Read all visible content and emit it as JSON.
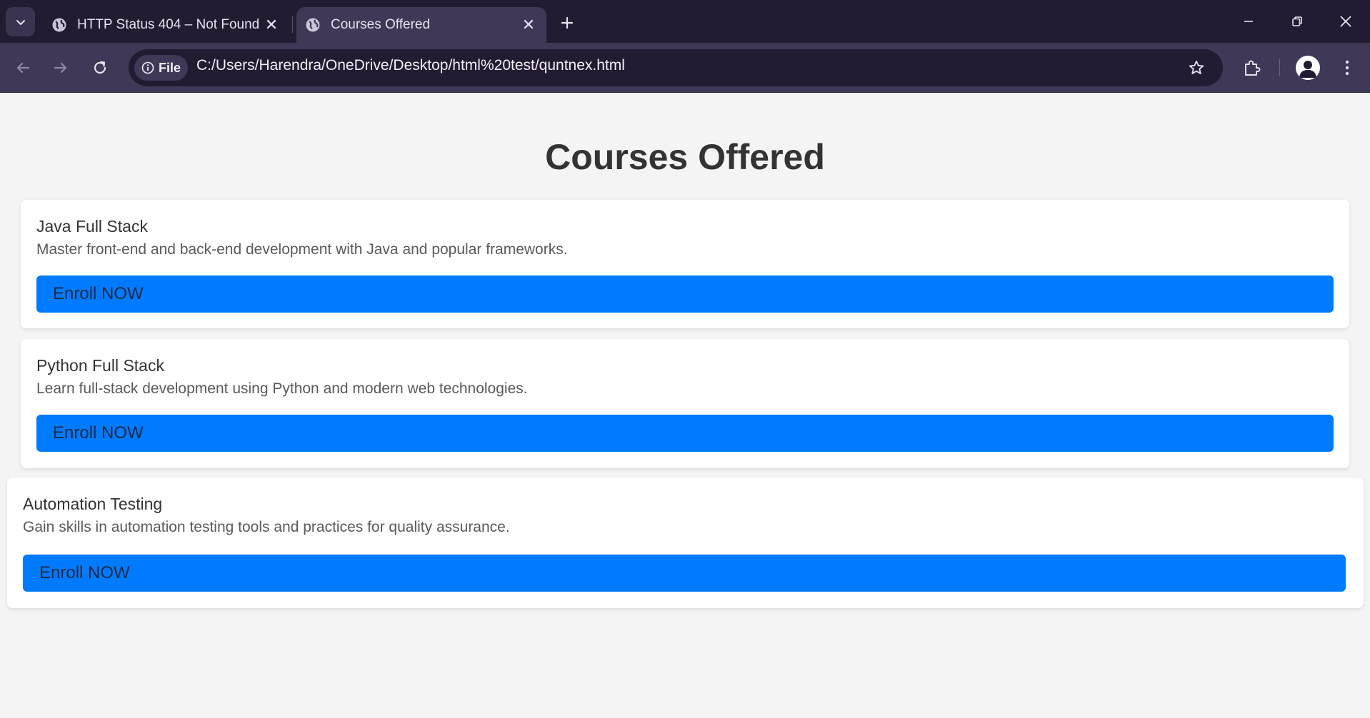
{
  "browser": {
    "tabs": [
      {
        "title": "HTTP Status 404 – Not Found",
        "active": false
      },
      {
        "title": "Courses Offered",
        "active": true
      }
    ],
    "address_chip": "File",
    "url": "C:/Users/Harendra/OneDrive/Desktop/html%20test/quntnex.html",
    "icons": {
      "tab_search": "chevron-down-icon",
      "favicon": "globe-icon",
      "close_tab": "close-icon",
      "new_tab": "plus-icon",
      "minimize": "minimize-icon",
      "restore": "restore-icon",
      "close_window": "close-icon",
      "back": "arrow-left-icon",
      "forward": "arrow-right-icon",
      "reload": "reload-icon",
      "site_info": "info-icon",
      "bookmark": "star-icon",
      "extensions": "puzzle-icon",
      "profile": "person-icon",
      "menu": "kebab-menu-icon"
    }
  },
  "page": {
    "title": "Courses Offered",
    "courses": [
      {
        "name": "Java Full Stack",
        "description": "Master front-end and back-end development with Java and popular frameworks.",
        "button": "Enroll NOW"
      },
      {
        "name": "Python Full Stack",
        "description": "Learn full-stack development using Python and modern web technologies.",
        "button": "Enroll NOW"
      },
      {
        "name": "Automation Testing",
        "description": "Gain skills in automation testing tools and practices for quality assurance.",
        "button": "Enroll NOW"
      }
    ]
  },
  "colors": {
    "titlebar": "#221c33",
    "toolbar": "#3f3856",
    "page_background": "#f4f4f4",
    "card_background": "#ffffff",
    "button": "#007bff",
    "heading_text": "#333333"
  }
}
